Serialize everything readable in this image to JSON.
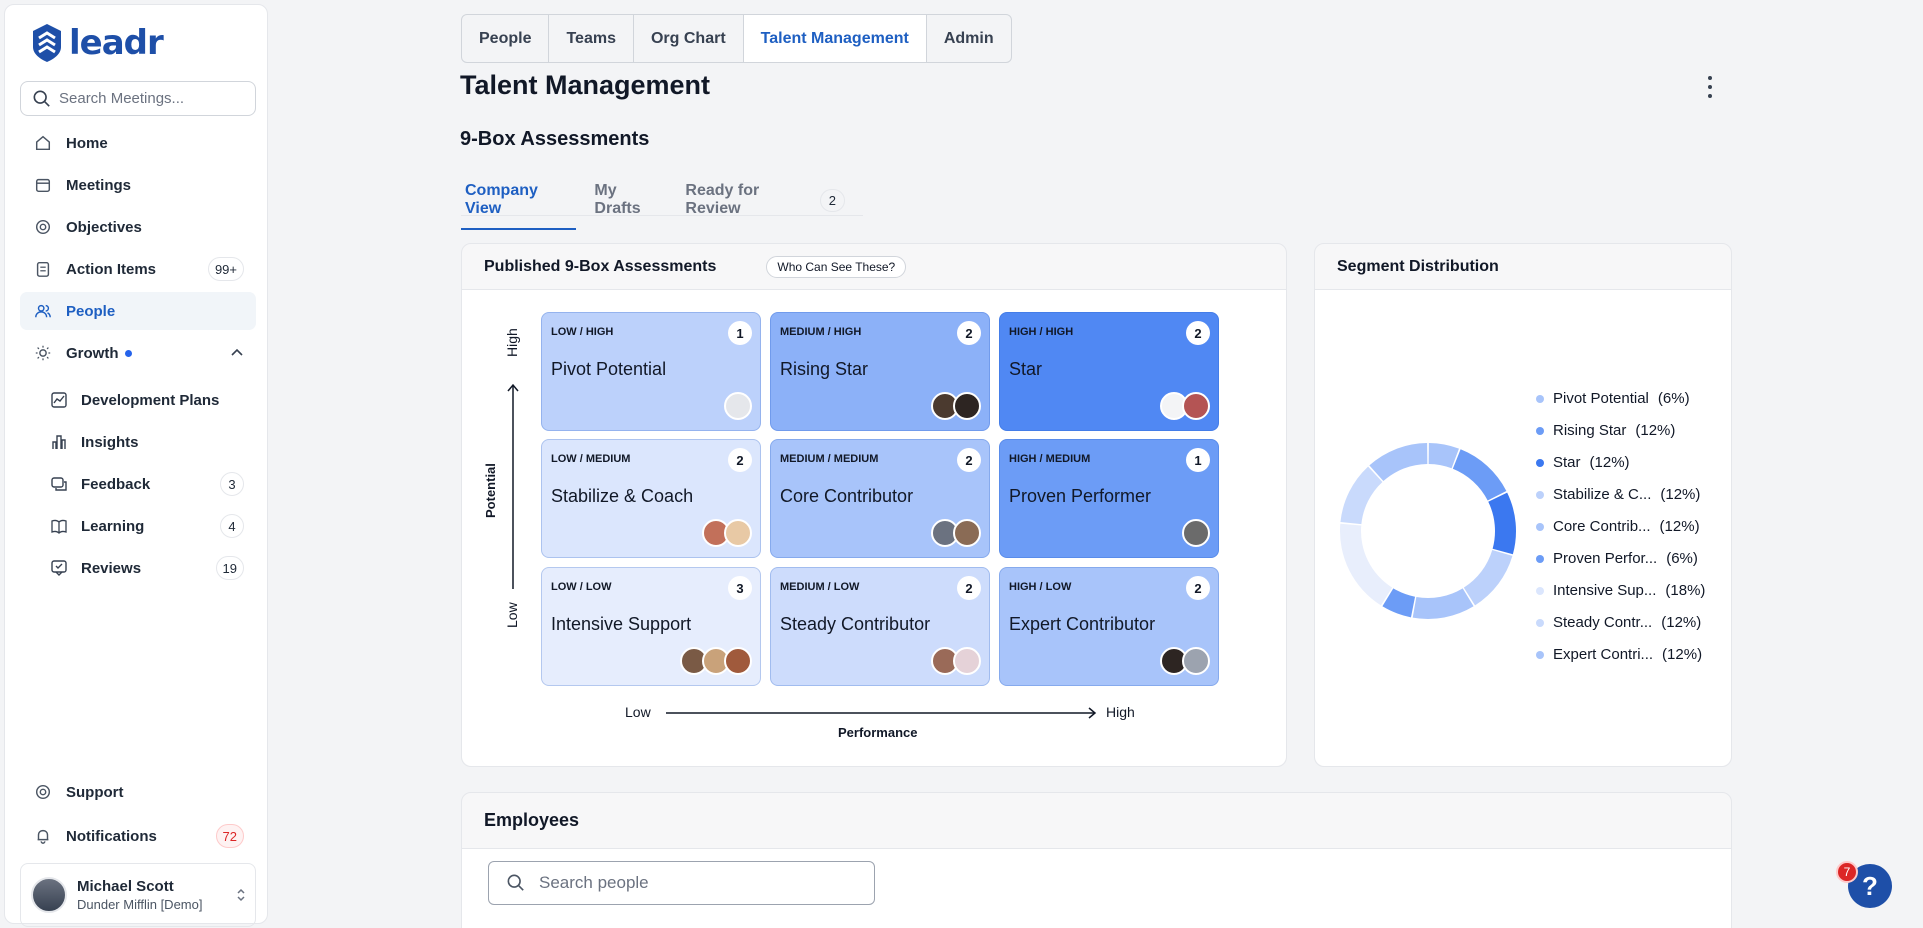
{
  "brand": {
    "logo_text": "leadr"
  },
  "sidebar": {
    "search_placeholder": "Search Meetings...",
    "items": [
      {
        "label": "Home",
        "icon": "home-icon"
      },
      {
        "label": "Meetings",
        "icon": "calendar-icon"
      },
      {
        "label": "Objectives",
        "icon": "target-icon"
      },
      {
        "label": "Action Items",
        "icon": "clipboard-icon",
        "badge": "99+"
      },
      {
        "label": "People",
        "icon": "people-icon",
        "active": true
      },
      {
        "label": "Growth",
        "icon": "sun-icon"
      }
    ],
    "growth_sub": [
      {
        "label": "Development Plans",
        "icon": "chart-icon"
      },
      {
        "label": "Insights",
        "icon": "bar-chart-icon"
      },
      {
        "label": "Feedback",
        "icon": "chat-icon",
        "badge": "3"
      },
      {
        "label": "Learning",
        "icon": "book-icon",
        "badge": "4"
      },
      {
        "label": "Reviews",
        "icon": "review-icon",
        "badge": "19"
      }
    ],
    "support_label": "Support",
    "notifications_label": "Notifications",
    "notifications_badge": "72",
    "user": {
      "name": "Michael Scott",
      "org": "Dunder Mifflin [Demo]"
    }
  },
  "topnav": {
    "tabs": [
      "People",
      "Teams",
      "Org Chart",
      "Talent Management",
      "Admin"
    ],
    "active": "Talent Management"
  },
  "page": {
    "title": "Talent Management",
    "section_title": "9-Box Assessments"
  },
  "subtabs": [
    {
      "label": "Company View",
      "active": true
    },
    {
      "label": "My Drafts"
    },
    {
      "label": "Ready for Review",
      "count": "2"
    }
  ],
  "published": {
    "title": "Published 9-Box Assessments",
    "who_label": "Who Can See These?",
    "y_axis": {
      "title": "Potential",
      "high": "High",
      "low": "Low"
    },
    "x_axis": {
      "title": "Performance",
      "low": "Low",
      "high": "High"
    },
    "boxes": [
      {
        "level": "LOW / HIGH",
        "name": "Pivot Potential",
        "count": "1"
      },
      {
        "level": "MEDIUM / HIGH",
        "name": "Rising Star",
        "count": "2"
      },
      {
        "level": "HIGH / HIGH",
        "name": "Star",
        "count": "2"
      },
      {
        "level": "LOW / MEDIUM",
        "name": "Stabilize & Coach",
        "count": "2"
      },
      {
        "level": "MEDIUM / MEDIUM",
        "name": "Core Contributor",
        "count": "2"
      },
      {
        "level": "HIGH / MEDIUM",
        "name": "Proven Performer",
        "count": "1"
      },
      {
        "level": "LOW / LOW",
        "name": "Intensive Support",
        "count": "3"
      },
      {
        "level": "MEDIUM / LOW",
        "name": "Steady Contributor",
        "count": "2"
      },
      {
        "level": "HIGH / LOW",
        "name": "Expert Contributor",
        "count": "2"
      }
    ]
  },
  "segment": {
    "title": "Segment Distribution",
    "legend": [
      {
        "label": "Pivot Potential",
        "pct": "(6%)",
        "value": 6,
        "color": "#a8c4fa"
      },
      {
        "label": "Rising Star",
        "pct": "(12%)",
        "value": 12,
        "color": "#6c9cf6"
      },
      {
        "label": "Star",
        "pct": "(12%)",
        "value": 12,
        "color": "#3b78f0"
      },
      {
        "label": "Stabilize & C...",
        "pct": "(12%)",
        "value": 12,
        "color": "#bcd1fb"
      },
      {
        "label": "Core Contrib...",
        "pct": "(12%)",
        "value": 12,
        "color": "#a8c4fa"
      },
      {
        "label": "Proven Perfor...",
        "pct": "(6%)",
        "value": 6,
        "color": "#6c9cf6"
      },
      {
        "label": "Intensive Sup...",
        "pct": "(18%)",
        "value": 18,
        "color": "#e8eefc"
      },
      {
        "label": "Steady Contr...",
        "pct": "(12%)",
        "value": 12,
        "color": "#c9dafc"
      },
      {
        "label": "Expert Contri...",
        "pct": "(12%)",
        "value": 12,
        "color": "#a8c4fa"
      }
    ]
  },
  "employees": {
    "title": "Employees",
    "search_placeholder": "Search people"
  },
  "help": {
    "label": "?",
    "badge": "7"
  }
}
